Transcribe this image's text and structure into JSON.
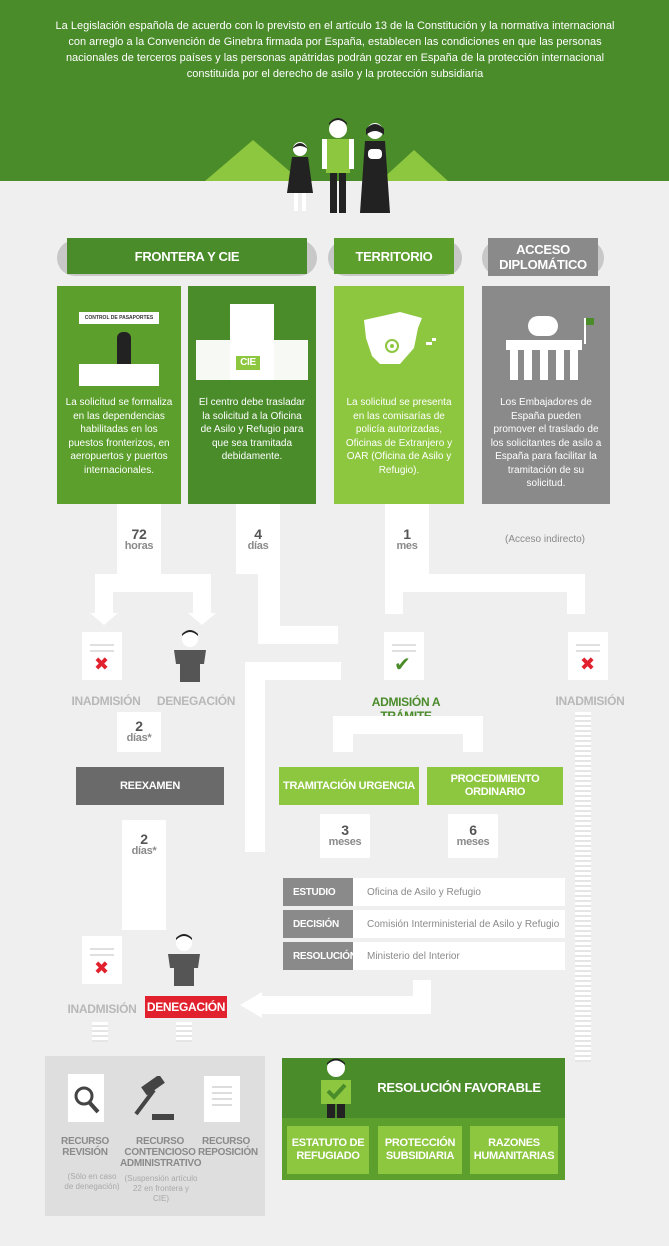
{
  "intro": "La Legislación española de acuerdo con lo previsto en el artículo 13 de la Constitución y la normativa internacional con arreglo a la Convención de Ginebra firmada por España, establecen las condiciones en que las personas nacionales de terceros países y las personas apátridas podrán gozar en España de la protección internacional constituida por el derecho de asilo y la protección subsidiaria",
  "colors": {
    "green_dark": "#4a8b2a",
    "green_mid": "#5c9f2c",
    "green_light": "#8dc63f",
    "gray": "#8a8a8a",
    "red": "#e1222e"
  },
  "tabs": {
    "frontera": "FRONTERA Y CIE",
    "territorio": "TERRITORIO",
    "diplomatico": "ACCESO DIPLOMÁTICO"
  },
  "cards": {
    "pasaportes_sign": "CONTROL DE PASAPORTES",
    "pasaportes_text": "La solicitud se formaliza en las dependencias habilitadas en los puestos fronterizos, en aeropuertos y puertos internacionales.",
    "cie_sign": "CIE",
    "cie_text": "El centro debe trasladar la solicitud a la Oficina de Asilo y Refugio para que sea tramitada debidamente.",
    "territorio_text": "La solicitud se presenta en las comisarías de policía autorizadas, Oficinas de Extranjero y OAR (Oficina de Asilo y Refugio).",
    "diplomatico_text": "Los Embajadores de España pueden promover el traslado de los solicitantes de asilo a España para facilitar la tramitación de su solicitud."
  },
  "times": {
    "t72_num": "72",
    "t72_unit": "horas",
    "t4_num": "4",
    "t4_unit": "días",
    "t1_num": "1",
    "t1_unit": "mes",
    "indirecto": "(Acceso indirecto)",
    "t2a_num": "2",
    "t2a_unit": "días*",
    "t2b_num": "2",
    "t2b_unit": "días*",
    "t3_num": "3",
    "t3_unit": "meses",
    "t6_num": "6",
    "t6_unit": "meses"
  },
  "outcomes": {
    "inadmision1": "INADMISIÓN",
    "denegacion1": "DENEGACIÓN",
    "admision": "ADMISIÓN A TRÁMITE",
    "inadmision2": "INADMISIÓN",
    "reexamen": "REEXAMEN",
    "urgencia": "TRAMITACIÓN URGENCIA",
    "ordinario": "PROCEDIMIENTO ORDINARIO",
    "inadmision3": "INADMISIÓN",
    "denegacion3": "DENEGACIÓN"
  },
  "steps": [
    {
      "label": "ESTUDIO",
      "value": "Oficina de Asilo y Refugio"
    },
    {
      "label": "DECISIÓN",
      "value": "Comisión Interministerial de Asilo y Refugio"
    },
    {
      "label": "RESOLUCIÓN",
      "value": "Ministerio del Interior"
    }
  ],
  "recursos": {
    "revision": "RECURSO REVISIÓN",
    "revision_note": "(Sólo en caso de denegación)",
    "contencioso": "RECURSO CONTENCIOSO ADMINISTRATIVO",
    "contencioso_note": "(Suspensión artículo 22 en frontera y CIE)",
    "reposicion": "RECURSO REPOSICIÓN"
  },
  "favorable": {
    "title": "RESOLUCIÓN FAVORABLE",
    "estatuto": "ESTATUTO DE REFUGIADO",
    "subsidiaria": "PROTECCIÓN SUBSIDIARIA",
    "humanitarias": "RAZONES HUMANITARIAS"
  }
}
